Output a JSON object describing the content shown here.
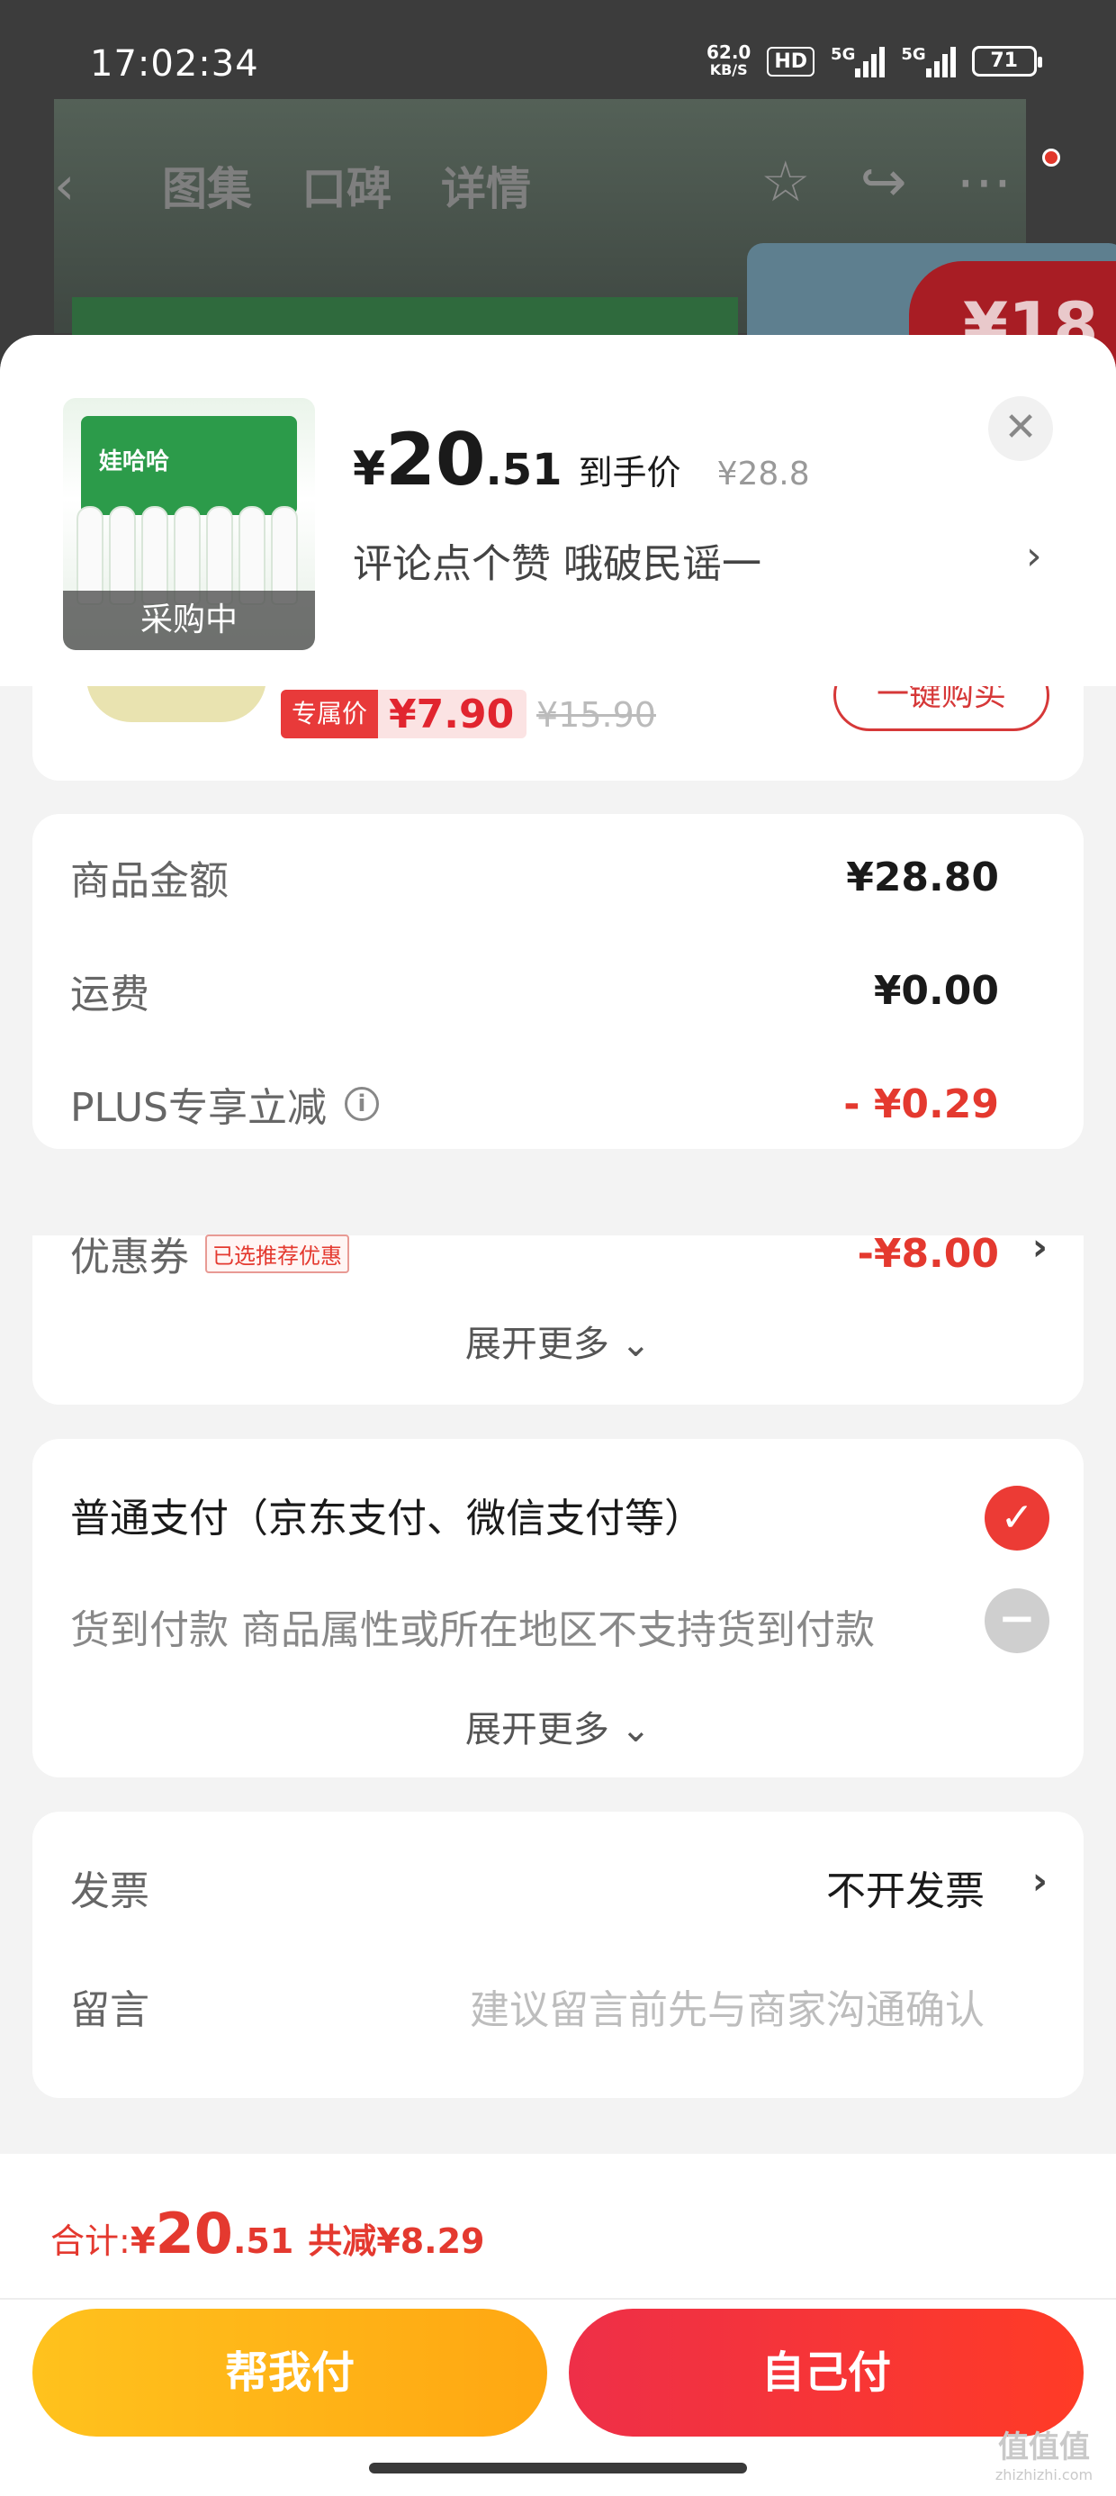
{
  "status": {
    "time": "17:02:34",
    "net_speed": "62.0",
    "net_unit": "KB/S",
    "hd": "HD",
    "sig1": "5G",
    "sig2": "5G",
    "battery": "71"
  },
  "nav": {
    "tabs": [
      "图集",
      "口碑",
      "详情"
    ]
  },
  "background": {
    "promo_text": "¥18"
  },
  "product": {
    "price_symbol": "¥",
    "price_int": "20",
    "price_dec": ".51",
    "price_label": "到手价",
    "orig_price": "¥28.8",
    "status_label": "采购中",
    "comment": "评论点个赞  哦破民谣一",
    "box_brand": "娃哈哈"
  },
  "recommend": {
    "tag": "专属价",
    "price": "¥7.90",
    "orig_price": "¥15.90",
    "button": "一键购买"
  },
  "summary": {
    "goods_label": "商品金额",
    "goods_value": "¥28.80",
    "shipping_label": "运费",
    "shipping_value": "¥0.00",
    "plus_label": "PLUS专享立减",
    "plus_value": "- ¥0.29",
    "coupon_label": "优惠券",
    "coupon_tag": "已选推荐优惠",
    "coupon_value": "-¥8.00",
    "expand": "展开更多"
  },
  "payment": {
    "normal": "普通支付（京东支付、微信支付等）",
    "cod": "货到付款 商品属性或所在地区不支持货到付款",
    "expand": "展开更多"
  },
  "extra": {
    "invoice_label": "发票",
    "invoice_value": "不开发票",
    "message_label": "留言",
    "message_placeholder": "建议留言前先与商家沟通确认"
  },
  "footer": {
    "total_label": "合计: ",
    "total_symbol": "¥",
    "total_int": "20",
    "total_dec": ".51",
    "discount": "共减¥8.29",
    "help_pay": "帮我付",
    "self_pay": "自己付"
  },
  "watermark": {
    "main": "值值值",
    "site": "zhizhizhi.com"
  }
}
